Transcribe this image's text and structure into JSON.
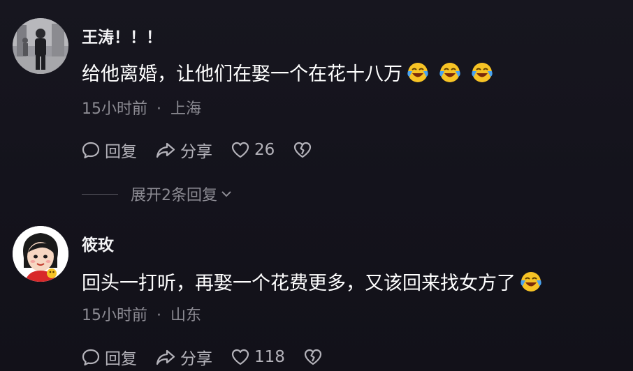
{
  "comments": [
    {
      "username": "王涛！！！",
      "text": "给他离婚，让他们在娶一个在花十八万",
      "emojis": [
        "laughing-crying-emoji",
        "laughing-crying-emoji",
        "laughing-crying-emoji"
      ],
      "time": "15小时前",
      "location": "上海",
      "reply_label": "回复",
      "share_label": "分享",
      "like_count": "26"
    },
    {
      "username": "筱玫",
      "text": "回头一打听，再娶一个花费更多，又该回来找女方了",
      "emojis": [
        "laughing-crying-emoji"
      ],
      "time": "15小时前",
      "location": "山东",
      "reply_label": "回复",
      "share_label": "分享",
      "like_count": "118"
    }
  ],
  "expand_replies": "展开2条回复",
  "dot": "·",
  "colors": {
    "background": "#15141c",
    "text_primary": "#ffffff",
    "text_secondary": "#8c8b93",
    "action_gray": "#b4b3ba",
    "emoji_yellow": "#f7c325",
    "emoji_tear": "#4aa3f0"
  }
}
